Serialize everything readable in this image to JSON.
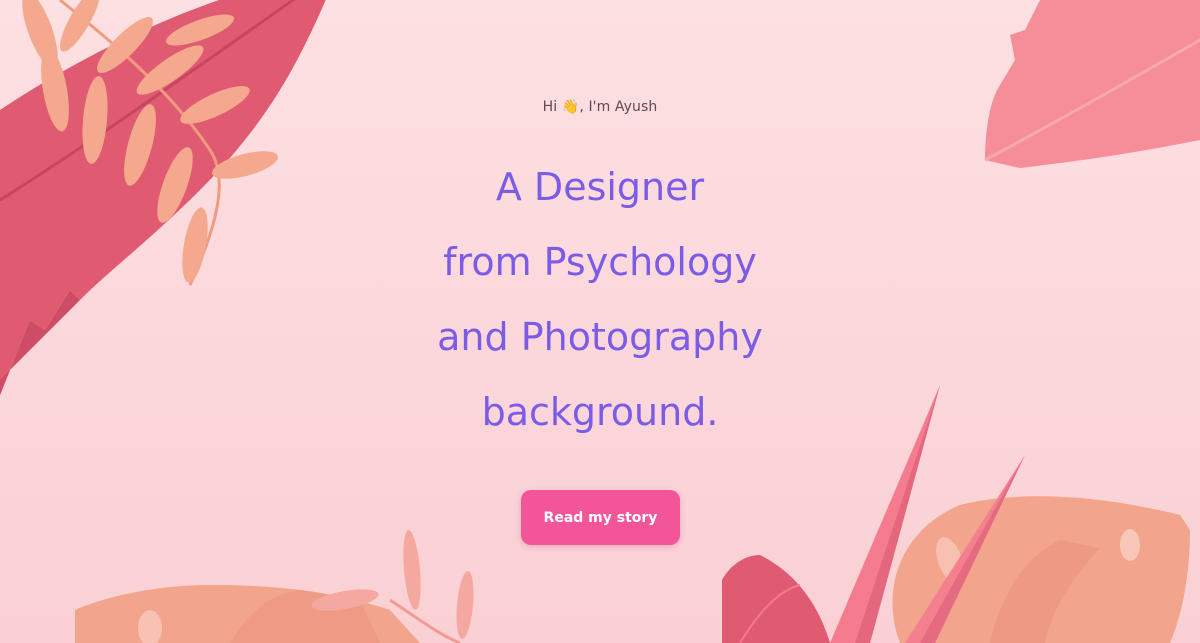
{
  "hero": {
    "greeting": "Hi 👋, I'm Ayush",
    "headline_lines": [
      "A Designer",
      "from Psychology",
      "and Photography",
      "background."
    ],
    "cta_label": "Read my story"
  },
  "colors": {
    "background": "#fde0e2",
    "headline": "#7a5ce6",
    "cta": "#f3559a",
    "leaf_dark": "#e05a72",
    "leaf_coral": "#f2a48c",
    "leaf_pink": "#f58e9a"
  },
  "decorations": [
    "pink-leaf-icon",
    "fern-icon",
    "monstera-leaf-icon",
    "grass-blade-icon"
  ]
}
